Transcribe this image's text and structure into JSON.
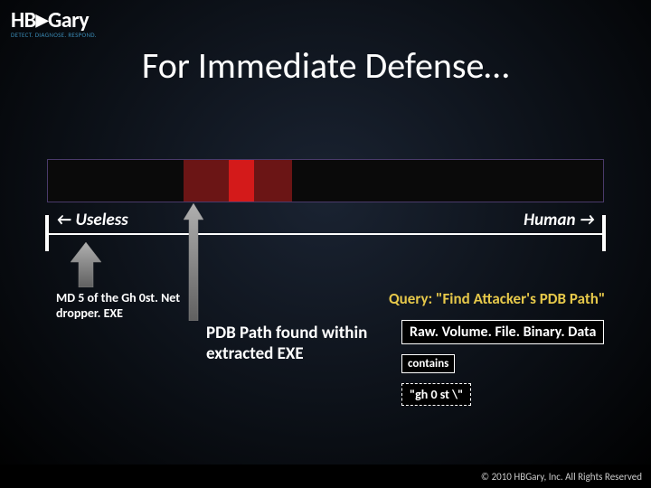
{
  "logo": {
    "hb": "HB",
    "gary": "Gary",
    "tagline": "DETECT. DIAGNOSE. RESPOND."
  },
  "title": "For Immediate Defense…",
  "scale": {
    "left_label": "← Useless",
    "right_label": "Human →"
  },
  "md5_label": "MD 5 of the Gh 0st. Net dropper. EXE",
  "pdb_label": "PDB Path found within extracted EXE",
  "query_label": "Query: \"Find Attacker's PDB Path\"",
  "boxes": {
    "raw": "Raw. Volume. File. Binary. Data",
    "contains": "contains",
    "ghost": "\"gh 0 st \\\""
  },
  "footer": "© 2010 HBGary, Inc. All Rights Reserved",
  "chart_data": {
    "type": "bar",
    "description": "Horizontal usefulness scale from Useless (left) to Human (right). A dark red band spans roughly 24%–44% of the width; a bright red marker sits at about 32%–37% of the width.",
    "axis": {
      "left": "Useless",
      "right": "Human",
      "range_pct": [
        0,
        100
      ]
    },
    "bands": [
      {
        "name": "dark-red-region",
        "start_pct": 24,
        "end_pct": 44,
        "color": "#6b1515"
      },
      {
        "name": "bright-red-marker",
        "start_pct": 32,
        "end_pct": 37,
        "color": "#d41a1a"
      }
    ],
    "annotations": [
      {
        "name": "md5-pointer",
        "position_pct": 6,
        "label": "MD 5 of the Gh 0st. Net dropper. EXE"
      },
      {
        "name": "pdb-pointer",
        "position_pct": 34,
        "label": "PDB Path found within extracted EXE"
      }
    ]
  }
}
